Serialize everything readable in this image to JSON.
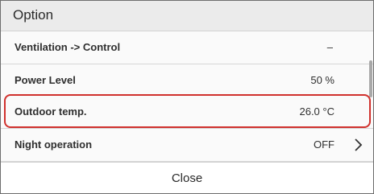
{
  "dialog": {
    "title": "Option",
    "rows": [
      {
        "label": "Ventilation -> Control",
        "value": "–"
      },
      {
        "label": "Power Level",
        "value": "50 %"
      },
      {
        "label": "Outdoor temp.",
        "value": "26.0 °C"
      },
      {
        "label": "Night operation",
        "value": "OFF"
      }
    ],
    "close_label": "Close",
    "highlight_color": "#d0312d",
    "chevron_icon": "chevron-right-icon"
  }
}
